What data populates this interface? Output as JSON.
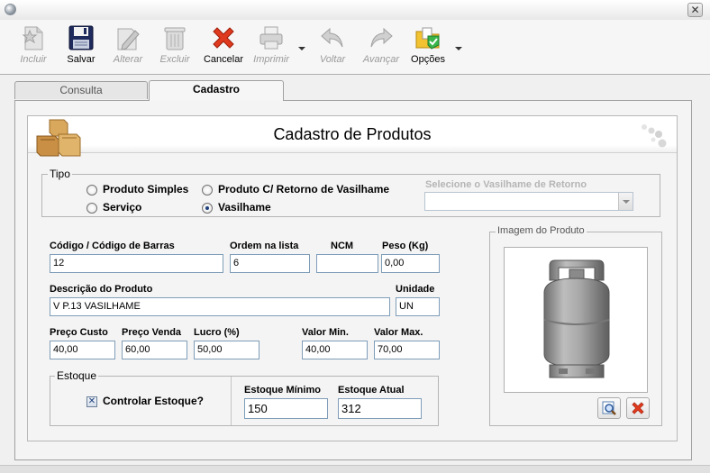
{
  "toolbar": {
    "items": [
      {
        "label": "Incluir",
        "enabled": false,
        "icon": "new-document-icon"
      },
      {
        "label": "Salvar",
        "enabled": true,
        "icon": "floppy-disk-icon"
      },
      {
        "label": "Alterar",
        "enabled": false,
        "icon": "edit-pencil-icon"
      },
      {
        "label": "Excluir",
        "enabled": false,
        "icon": "trash-can-icon"
      },
      {
        "label": "Cancelar",
        "enabled": true,
        "icon": "red-x-icon"
      },
      {
        "label": "Imprimir",
        "enabled": false,
        "icon": "printer-icon"
      },
      {
        "label": "Voltar",
        "enabled": false,
        "icon": "arrow-back-icon"
      },
      {
        "label": "Avançar",
        "enabled": false,
        "icon": "arrow-forward-icon"
      },
      {
        "label": "Opções",
        "enabled": true,
        "icon": "options-folder-icon"
      }
    ]
  },
  "tabs": [
    {
      "label": "Consulta",
      "active": false
    },
    {
      "label": "Cadastro",
      "active": true
    }
  ],
  "page_title": "Cadastro de Produtos",
  "tipo": {
    "legend": "Tipo",
    "options": [
      {
        "label": "Produto Simples",
        "selected": false
      },
      {
        "label": "Produto C/ Retorno de Vasilhame",
        "selected": false
      },
      {
        "label": "Serviço",
        "selected": false
      },
      {
        "label": "Vasilhame",
        "selected": true
      }
    ],
    "vasilhame_retorno_label": "Selecione o Vasilhame de Retorno",
    "vasilhame_retorno_value": ""
  },
  "fields": {
    "codigo": {
      "label": "Código / Código de  Barras",
      "value": "12"
    },
    "ordem": {
      "label": "Ordem na lista",
      "value": "6"
    },
    "ncm": {
      "label": "NCM",
      "value": ""
    },
    "peso": {
      "label": "Peso (Kg)",
      "value": "0,00"
    },
    "descricao": {
      "label": "Descrição do Produto",
      "value": "V P.13 VASILHAME"
    },
    "unidade": {
      "label": "Unidade",
      "value": "UN"
    },
    "preco_custo": {
      "label": "Preço Custo",
      "value": "40,00"
    },
    "preco_venda": {
      "label": "Preço Venda",
      "value": "60,00"
    },
    "lucro": {
      "label": "Lucro (%)",
      "value": "50,00"
    },
    "valor_min": {
      "label": "Valor Min.",
      "value": "40,00"
    },
    "valor_max": {
      "label": "Valor Max.",
      "value": "70,00"
    }
  },
  "estoque": {
    "legend": "Estoque",
    "controlar_label": "Controlar Estoque?",
    "controlar_checked": true,
    "minimo_label": "Estoque Mínimo",
    "minimo_value": "150",
    "atual_label": "Estoque Atual",
    "atual_value": "312"
  },
  "imagem": {
    "legend": "Imagem do Produto",
    "image_icon": "gas-cylinder-image",
    "search_icon": "image-search-icon",
    "remove_icon": "remove-image-icon"
  },
  "colors": {
    "accent_red": "#e03a1e",
    "field_border": "#7f9db9",
    "radio_dot": "#1c3f7a"
  }
}
